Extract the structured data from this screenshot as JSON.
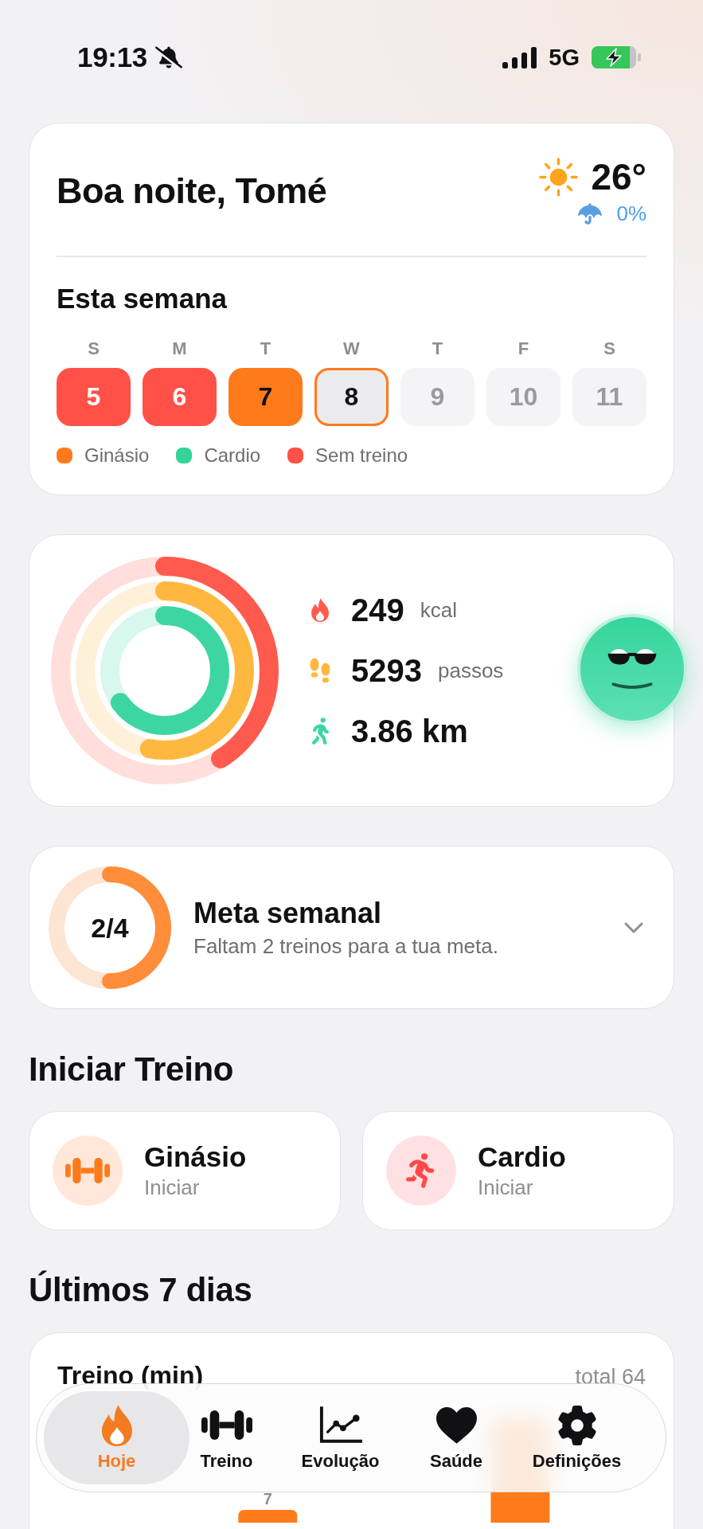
{
  "status_bar": {
    "time": "19:13",
    "network": "5G"
  },
  "greeting_card": {
    "greeting": "Boa noite, Tomé",
    "weather": {
      "temperature": "26°",
      "rain_chance": "0%"
    },
    "week_title": "Esta semana",
    "days": [
      {
        "letter": "S",
        "date": "5",
        "kind": "missed",
        "selected": false
      },
      {
        "letter": "M",
        "date": "6",
        "kind": "missed",
        "selected": false
      },
      {
        "letter": "T",
        "date": "7",
        "kind": "gym",
        "selected": false
      },
      {
        "letter": "W",
        "date": "8",
        "kind": "upcoming",
        "selected": true
      },
      {
        "letter": "T",
        "date": "9",
        "kind": "upcoming",
        "selected": false
      },
      {
        "letter": "F",
        "date": "10",
        "kind": "upcoming",
        "selected": false
      },
      {
        "letter": "S",
        "date": "11",
        "kind": "upcoming",
        "selected": false
      }
    ],
    "legend": [
      {
        "label": "Ginásio",
        "color": "#ff7a1a"
      },
      {
        "label": "Cardio",
        "color": "#34d39a"
      },
      {
        "label": "Sem treino",
        "color": "#ff5147"
      }
    ]
  },
  "activity": {
    "metrics": [
      {
        "kind": "calories",
        "value": "249",
        "unit": "kcal",
        "level": 0.41,
        "color": "#ff5a4e"
      },
      {
        "kind": "steps",
        "value": "5293",
        "unit": "passos",
        "level": 0.53,
        "color": "#ffb83f"
      },
      {
        "kind": "distance",
        "value": "3.86 km",
        "level": 0.65,
        "color": "#3dd6a3"
      }
    ]
  },
  "weekly_goal": {
    "progress": "2/4",
    "level": 0.5,
    "title": "Meta semanal",
    "subtitle": "Faltam 2 treinos para a tua meta.",
    "expanded": false
  },
  "start_workout": {
    "title": "Iniciar Treino",
    "options": [
      {
        "kind": "gym",
        "title": "Ginásio",
        "action": "Iniciar"
      },
      {
        "kind": "cardio",
        "title": "Cardio",
        "action": "Iniciar"
      }
    ]
  },
  "last_7_days": {
    "title": "Últimos 7 dias",
    "card_title": "Treino (min)",
    "total": "total 64",
    "bar_label": "7"
  },
  "tab_bar": {
    "tabs": [
      {
        "kind": "today",
        "label": "Hoje",
        "selected": true
      },
      {
        "kind": "workout",
        "label": "Treino",
        "selected": false
      },
      {
        "kind": "progress",
        "label": "Evolução",
        "selected": false
      },
      {
        "kind": "health",
        "label": "Saúde",
        "selected": false
      },
      {
        "kind": "settings",
        "label": "Definições",
        "selected": false
      }
    ]
  }
}
